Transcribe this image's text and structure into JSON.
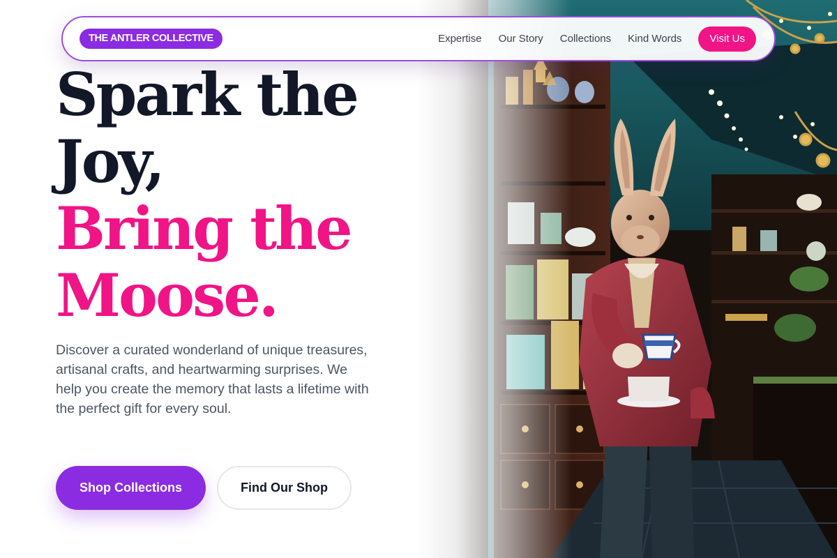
{
  "brand": {
    "logo_text": "THE ANTLER COLLECTIVE"
  },
  "nav": {
    "links": [
      "Expertise",
      "Our Story",
      "Collections",
      "Kind Words"
    ],
    "cta_label": "Visit Us"
  },
  "hero": {
    "headline_dark": [
      "Spark the",
      "Joy,"
    ],
    "headline_pink": [
      "Bring the",
      "Moose."
    ],
    "description": "Discover a curated wonderland of unique treasures, artisanal crafts, and heartwarming surprises. We help you create the memory that lasts a lifetime with the perfect gift for every soul.",
    "primary_cta": "Shop Collections",
    "secondary_cta": "Find Our Shop"
  },
  "colors": {
    "brand_purple": "#8b2be2",
    "accent_pink": "#f01486",
    "headline_dark": "#121827",
    "body_text": "#4b5563"
  }
}
